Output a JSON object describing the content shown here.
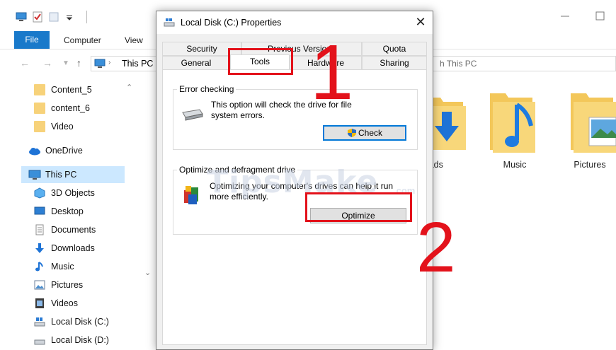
{
  "explorer": {
    "ribbon": {
      "file": "File",
      "computer": "Computer",
      "view": "View"
    },
    "address": "This PC",
    "search_placeholder": "h This PC",
    "nav": [
      {
        "label": "Content_5",
        "icon": "folder-icon"
      },
      {
        "label": "content_6",
        "icon": "folder-icon"
      },
      {
        "label": "Video",
        "icon": "folder-icon"
      },
      {
        "label": "OneDrive",
        "icon": "cloud-icon"
      },
      {
        "label": "This PC",
        "icon": "computer-icon"
      },
      {
        "label": "3D Objects",
        "icon": "3d-objects-icon"
      },
      {
        "label": "Desktop",
        "icon": "desktop-icon"
      },
      {
        "label": "Documents",
        "icon": "documents-icon"
      },
      {
        "label": "Downloads",
        "icon": "download-icon"
      },
      {
        "label": "Music",
        "icon": "music-icon"
      },
      {
        "label": "Pictures",
        "icon": "pictures-icon"
      },
      {
        "label": "Videos",
        "icon": "videos-icon"
      },
      {
        "label": "Local Disk (C:)",
        "icon": "drive-icon"
      },
      {
        "label": "Local Disk (D:)",
        "icon": "drive-icon"
      }
    ],
    "folders": [
      {
        "label": "loads"
      },
      {
        "label": "Music"
      },
      {
        "label": "Pictures"
      }
    ]
  },
  "dialog": {
    "title": "Local Disk (C:) Properties",
    "tabs_row1": [
      "Security",
      "Previous Versions",
      "Quota"
    ],
    "tabs_row2": [
      "General",
      "Tools",
      "Hardware",
      "Sharing"
    ],
    "error_checking": {
      "title": "Error checking",
      "text_line1": "This option will check the drive for file",
      "text_line2": "system errors.",
      "button": "Check"
    },
    "optimize": {
      "title": "Optimize and defragment drive",
      "text_line1": "Optimizing your computer's drives can help it run",
      "text_line2": "more efficiently.",
      "button": "Optimize"
    }
  },
  "annotations": {
    "step1": "1",
    "step2": "2"
  },
  "watermark": "TipsMake",
  "watermark_suffix": ".com",
  "colors": {
    "accent": "#0078d7",
    "highlight": "#e3121b",
    "file_tab": "#1979ca",
    "selected": "#cce8ff"
  }
}
